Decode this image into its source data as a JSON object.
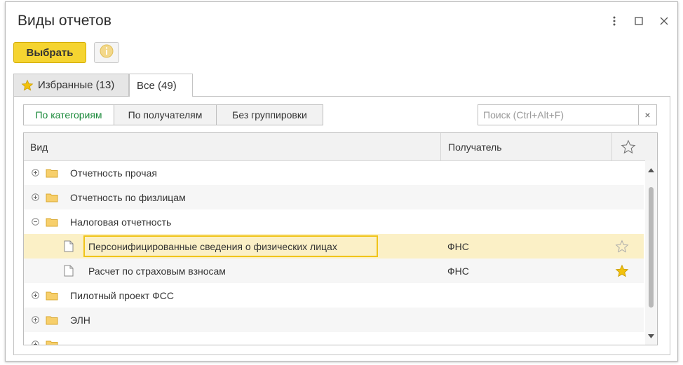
{
  "window": {
    "title": "Виды отчетов",
    "controls": [
      "more-icon",
      "maximize-icon",
      "close-icon"
    ]
  },
  "toolbar": {
    "select_label": "Выбрать",
    "info_icon": "info-icon"
  },
  "tabs": [
    {
      "label": "Избранные (13)",
      "icon": "star-icon",
      "active": false
    },
    {
      "label": "Все (49)",
      "active": true
    }
  ],
  "grouping": [
    {
      "label": "По категориям",
      "active": true
    },
    {
      "label": "По получателям",
      "active": false
    },
    {
      "label": "Без группировки",
      "active": false
    }
  ],
  "search": {
    "placeholder": "Поиск (Ctrl+Alt+F)",
    "value": "",
    "clear": "×"
  },
  "table": {
    "columns": {
      "kind": "Вид",
      "recipient": "Получатель",
      "favorite_icon": "star-outline-icon"
    },
    "rows": [
      {
        "type": "folder",
        "expander": "+",
        "name": "Отчетность прочая",
        "recipient": ""
      },
      {
        "type": "folder",
        "expander": "+",
        "name": "Отчетность по физлицам",
        "recipient": ""
      },
      {
        "type": "folder",
        "expander": "−",
        "name": "Налоговая отчетность",
        "recipient": ""
      },
      {
        "type": "doc",
        "name": "Персонифицированные сведения о физических лицах",
        "recipient": "ФНС",
        "favorite": false,
        "selected": true
      },
      {
        "type": "doc",
        "name": "Расчет по страховым взносам",
        "recipient": "ФНС",
        "favorite": true
      },
      {
        "type": "folder",
        "expander": "+",
        "name": "Пилотный проект ФСС",
        "recipient": ""
      },
      {
        "type": "folder",
        "expander": "+",
        "name": "ЭЛН",
        "recipient": ""
      }
    ]
  },
  "colors": {
    "accent_yellow": "#f5d431",
    "active_green": "#1b8a3b",
    "selected_row": "#fbf0c6",
    "star_gold": "#f2c10d"
  }
}
